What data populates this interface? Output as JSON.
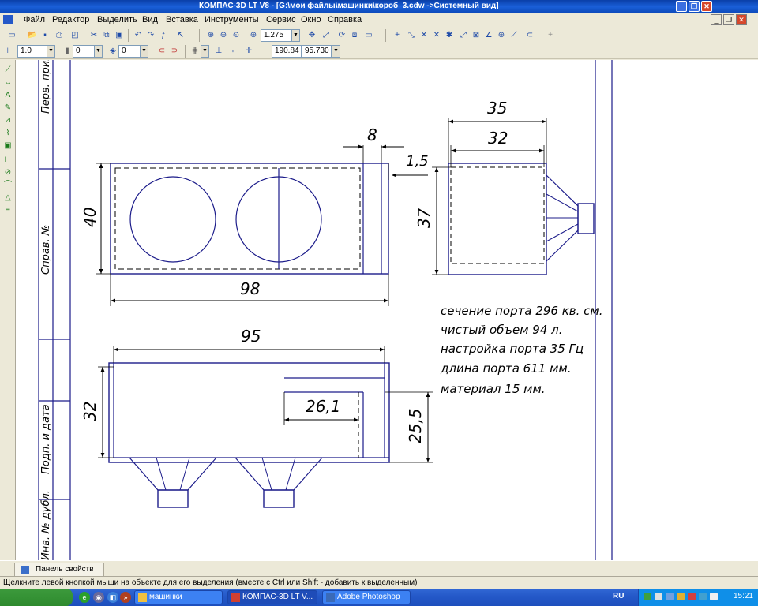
{
  "window": {
    "title": "КОМПАС-3D LT V8 - [G:\\мои файлы\\машинки\\короб_3.cdw ->Системный вид]"
  },
  "menu": [
    "Файл",
    "Редактор",
    "Выделить",
    "Вид",
    "Вставка",
    "Инструменты",
    "Сервис",
    "Окно",
    "Справка"
  ],
  "toolbar1": {
    "zoom_value": "1.275"
  },
  "toolbar2": {
    "line_scale": "1.0",
    "layer_value": "0",
    "style_value": "0",
    "coord_x": "190.84",
    "coord_y": "95.730"
  },
  "drawing": {
    "title_block": [
      "Перв. прим.",
      "Справ. №",
      "Подп. и дата",
      "Инв. № дубл."
    ],
    "dims": {
      "top_width": "98",
      "top_height": "40",
      "port_width": "8",
      "port_gap": "1,5",
      "side_outer": "35",
      "side_inner": "32",
      "side_height": "37",
      "front_width": "95",
      "front_height": "32",
      "port_length": "26,1",
      "port_height": "25,5"
    },
    "notes": [
      "сечение порта 296 кв. см.",
      "чистый объем 94 л.",
      "настройка порта 35 Гц",
      "длина порта 611 мм.",
      "материал 15 мм."
    ]
  },
  "properties_panel": {
    "label": "Панель свойств"
  },
  "status": {
    "text": "Щелкните левой кнопкой мыши на объекте для его выделения (вместе с Ctrl или Shift - добавить к выделенным)"
  },
  "taskbar": {
    "tasks": [
      "машинки",
      "КОМПАС-3D LT V...",
      "Adobe Photoshop"
    ],
    "language": "RU",
    "clock": "15:21"
  },
  "colors": {
    "line": "#1c1c8a",
    "title_bar": "#0a3fa8",
    "taskbar": "#2458c8"
  }
}
